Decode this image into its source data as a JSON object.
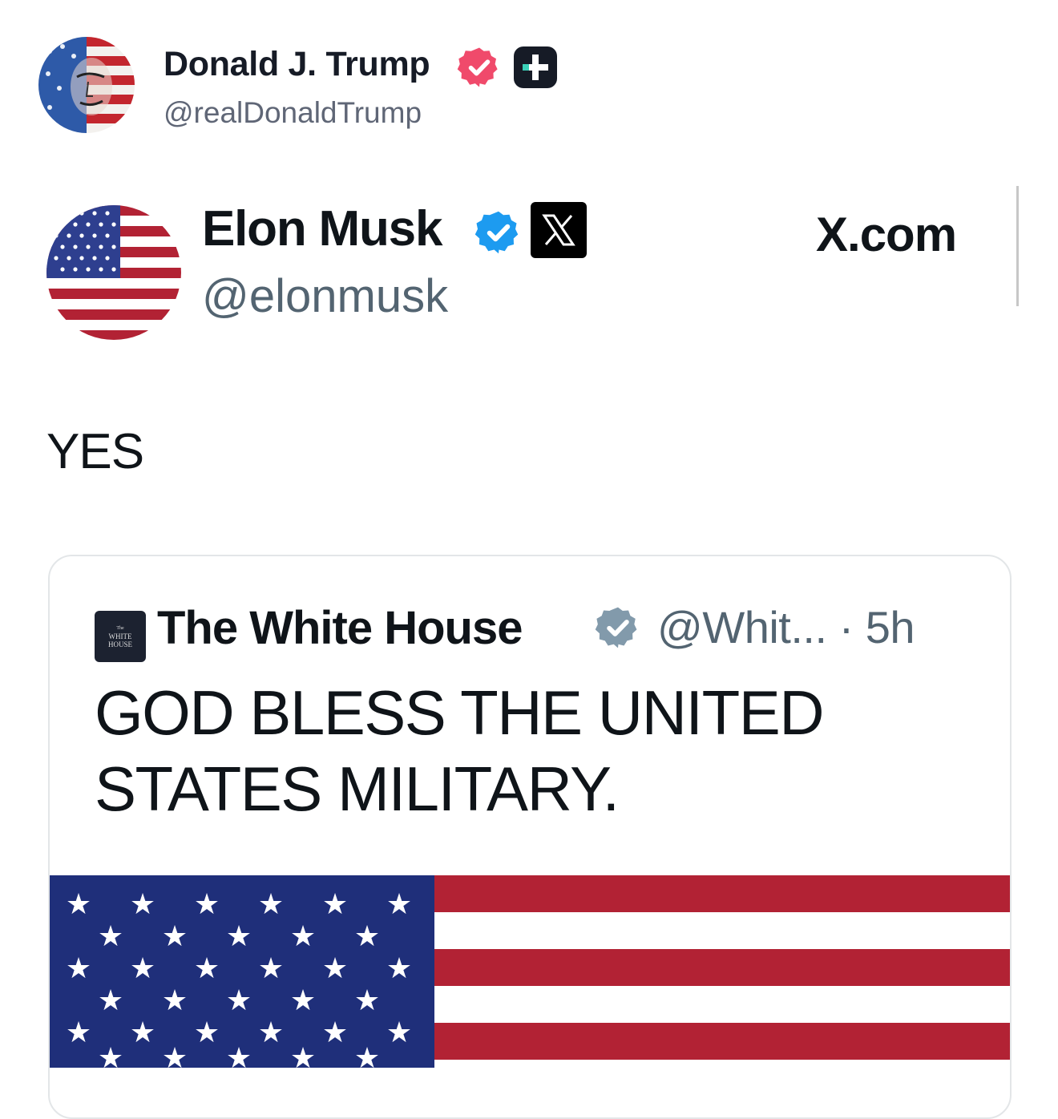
{
  "post": {
    "author_name": "Donald J. Trump",
    "author_handle": "@realDonaldTrump",
    "icons": [
      "verified-badge-icon",
      "plus-badge-icon",
      "flag-portrait-avatar"
    ]
  },
  "screenshot": {
    "author_name": "Elon Musk",
    "author_handle": "@elonmusk",
    "site_label": "X.com",
    "badge_icon": "x-logo-icon",
    "text": "YES",
    "quote": {
      "author_name": "The White House",
      "logo_lines": [
        "The",
        "WHITE",
        "HOUSE"
      ],
      "handle_time": "@Whit... · 5h",
      "text": "GOD BLESS THE UNITED STATES MILITARY.",
      "media": "american-flag-image"
    }
  },
  "colors": {
    "truth_verified": "#f04a6b",
    "x_verified": "#1d9bf0",
    "gov_verified": "#829aab",
    "flag_red": "#b22234",
    "flag_blue": "#1f2f7a"
  }
}
